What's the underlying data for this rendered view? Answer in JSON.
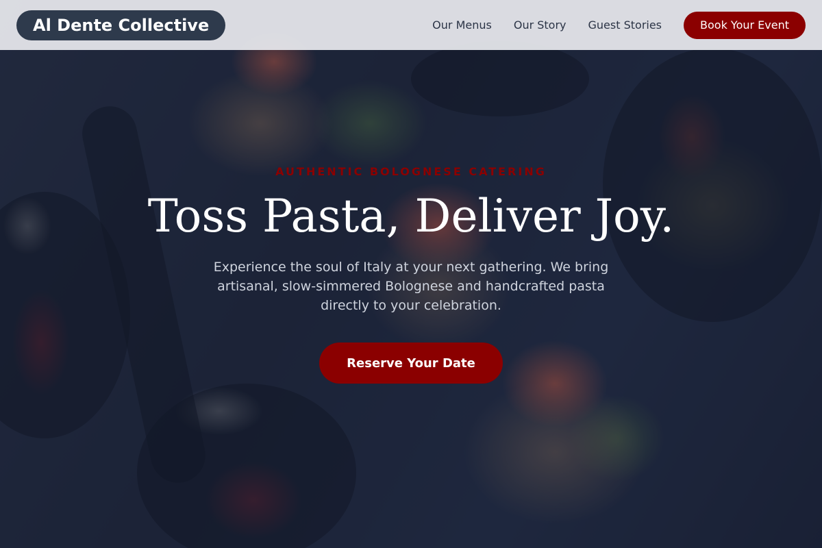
{
  "brand": {
    "name": "Al Dente Collective"
  },
  "nav": {
    "links": [
      "Our Menus",
      "Our Story",
      "Guest Stories"
    ],
    "cta": "Book Your Event"
  },
  "hero": {
    "eyebrow": "AUTHENTIC BOLOGNESE CATERING",
    "headline": "Toss Pasta, Deliver Joy.",
    "subtext": "Experience the soul of Italy at your next gathering. We bring artisanal, slow-simmered Bolognese and handcrafted pasta directly to your celebration.",
    "cta": "Reserve Your Date"
  },
  "colors": {
    "accent": "#8b0000",
    "brand_pill": "#2e3a4c",
    "nav_bg": "#e8eaee",
    "overlay": "#192037"
  }
}
